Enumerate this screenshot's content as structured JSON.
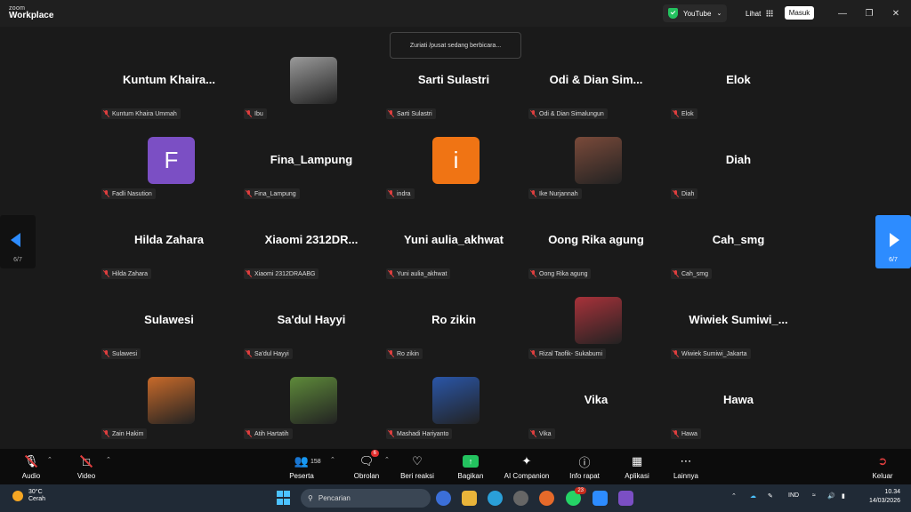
{
  "app": {
    "logo_top": "zoom",
    "logo_bottom": "Workplace"
  },
  "titlebar": {
    "youtube_label": "YouTube",
    "view_label": "Lihat",
    "signin_label": "Masuk"
  },
  "speaker_toast": "Zuriati /pusat sedang berbicara...",
  "pager": {
    "left": "6/7",
    "right": "6/7"
  },
  "participants": [
    {
      "display": "Kuntum  Khaira...",
      "tag": "Kuntum Khaira Ummah",
      "type": "name"
    },
    {
      "display": "",
      "tag": "Ibu",
      "type": "photo",
      "photo_color": "#9a9a9a"
    },
    {
      "display": "Sarti Sulastri",
      "tag": "Sarti Sulastri",
      "type": "name"
    },
    {
      "display": "Odi & Dian Sim...",
      "tag": "Odi & Dian Simalungun",
      "type": "name"
    },
    {
      "display": "Elok",
      "tag": "Elok",
      "type": "name"
    },
    {
      "display": "F",
      "tag": "Fadli Nasution",
      "type": "letter",
      "color": "#7b4fc4"
    },
    {
      "display": "Fina_Lampung",
      "tag": "Fina_Lampung",
      "type": "name"
    },
    {
      "display": "i",
      "tag": "indra",
      "type": "letter",
      "color": "#f07414"
    },
    {
      "display": "",
      "tag": "Ike Nurjannah",
      "type": "photo",
      "photo_color": "#7a4a3a"
    },
    {
      "display": "Diah",
      "tag": "Diah",
      "type": "name"
    },
    {
      "display": "Hilda Zahara",
      "tag": "Hilda Zahara",
      "type": "name"
    },
    {
      "display": "Xiaomi  2312DR...",
      "tag": "Xiaomi 2312DRAABG",
      "type": "name"
    },
    {
      "display": "Yuni aulia_akhwat",
      "tag": "Yuni aulia_akhwat",
      "type": "name"
    },
    {
      "display": "Oong Rika agung",
      "tag": "Oong Rika agung",
      "type": "name"
    },
    {
      "display": "Cah_smg",
      "tag": "Cah_smg",
      "type": "name"
    },
    {
      "display": "Sulawesi",
      "tag": "Sulawesi",
      "type": "name"
    },
    {
      "display": "Sa'dul Hayyi",
      "tag": "Sa'dul Hayyi",
      "type": "name"
    },
    {
      "display": "Ro zikin",
      "tag": "Ro zikin",
      "type": "name"
    },
    {
      "display": "",
      "tag": "Rizal Taofik- Sukabumi",
      "type": "photo",
      "photo_color": "#a8323a"
    },
    {
      "display": "Wiwiek  Sumiwi_...",
      "tag": "Wiwiek Sumiwi_Jakarta",
      "type": "name"
    },
    {
      "display": "",
      "tag": "Zain Hakim",
      "type": "photo",
      "photo_color": "#c86a2a"
    },
    {
      "display": "",
      "tag": "Atih Hartatih",
      "type": "photo",
      "photo_color": "#5e8a3a"
    },
    {
      "display": "",
      "tag": "Mashadi Hariyanto",
      "type": "photo",
      "photo_color": "#2a56a8"
    },
    {
      "display": "Vika",
      "tag": "Vika",
      "type": "name"
    },
    {
      "display": "Hawa",
      "tag": "Hawa",
      "type": "name"
    }
  ],
  "toolbar": {
    "audio": "Audio",
    "video": "Video",
    "participants_label": "Peserta",
    "participants_count": "158",
    "chat": "Obrolan",
    "chat_badge": "6",
    "reactions": "Beri reaksi",
    "share": "Bagikan",
    "ai": "AI Companion",
    "info": "Info rapat",
    "apps": "Aplikasi",
    "more": "Lainnya",
    "leave": "Keluar"
  },
  "taskbar": {
    "temperature": "30°C",
    "weather": "Cerah",
    "search_placeholder": "Pencarian",
    "whatsapp_badge": "23",
    "language": "IND",
    "time": "10.34",
    "date": "14/03/2026"
  }
}
